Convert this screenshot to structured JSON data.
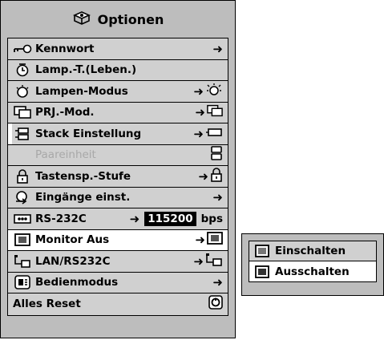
{
  "menu": {
    "title": "Optionen",
    "title_icon": "options-icon",
    "items": [
      {
        "label": "Kennwort",
        "icon": "key-icon",
        "right_arrow": "➜"
      },
      {
        "label": "Lamp.-T.(Leben.)",
        "icon": "lamp-timer-icon"
      },
      {
        "label": "Lampen-Modus",
        "icon": "lamp-icon",
        "right_arrow": "➜"
      },
      {
        "label": "PRJ.-Mod.",
        "icon": "projection-mode-icon",
        "right_arrow": "➜"
      },
      {
        "label": "Stack Einstellung",
        "icon": "stack-icon",
        "right_arrow": "➜"
      },
      {
        "label": "Paareinheit",
        "icon": "pair-unit-icon"
      },
      {
        "label": "Tastensp.-Stufe",
        "icon": "lock-icon",
        "right_arrow": "➜"
      },
      {
        "label": "Eingänge einst.",
        "icon": "input-icon",
        "right_arrow": "➜"
      },
      {
        "label": "RS-232C",
        "icon": "rs232c-icon",
        "right_arrow": "➜",
        "value": "115200",
        "unit": "bps"
      },
      {
        "label": "Monitor Aus",
        "icon": "monitor-icon",
        "right_arrow": "➜"
      },
      {
        "label": "LAN/RS232C",
        "icon": "lan-icon",
        "right_arrow": "➜"
      },
      {
        "label": "Bedienmodus",
        "icon": "control-mode-icon",
        "right_arrow": "➜"
      },
      {
        "label": "Alles Reset",
        "icon": "reset-icon"
      }
    ]
  },
  "submenu": {
    "items": [
      {
        "label": "Einschalten",
        "icon": "monitor-on-icon"
      },
      {
        "label": "Ausschalten",
        "icon": "monitor-off-icon",
        "selected": true
      }
    ]
  }
}
